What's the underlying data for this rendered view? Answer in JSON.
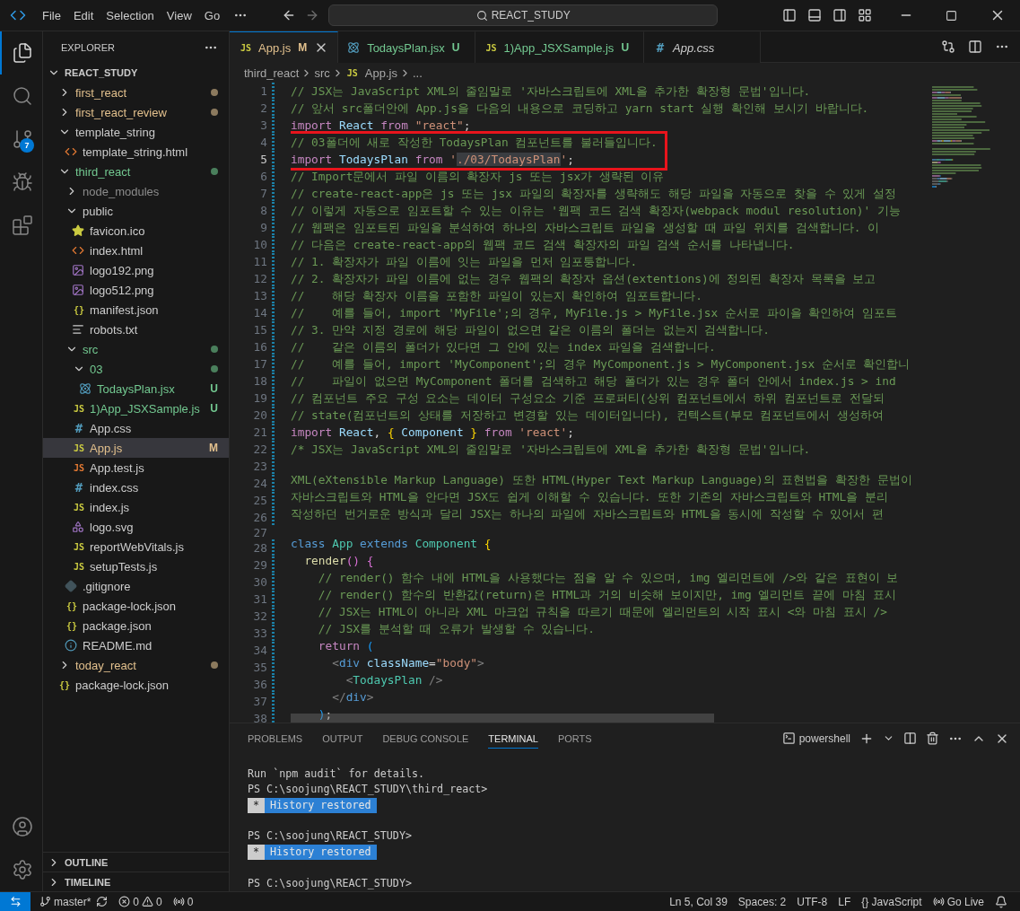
{
  "title_bar": {
    "menu": [
      "File",
      "Edit",
      "Selection",
      "View",
      "Go"
    ],
    "search": "REACT_STUDY"
  },
  "activity_bar": {
    "items": [
      {
        "kind": "explorer",
        "selected": true
      },
      {
        "kind": "search",
        "selected": false
      },
      {
        "kind": "source_control",
        "selected": false,
        "badge": "7"
      },
      {
        "kind": "run_debug",
        "selected": false
      },
      {
        "kind": "extensions",
        "selected": false
      }
    ],
    "bottom": [
      {
        "kind": "account"
      },
      {
        "kind": "settings"
      }
    ]
  },
  "sidebar": {
    "title": "EXPLORER",
    "root": {
      "label": "REACT_STUDY",
      "expanded": true,
      "children": [
        {
          "label": "first_react",
          "kind": "folder",
          "expanded": false,
          "color": "#e2c08d",
          "dot": true,
          "selected": false
        },
        {
          "label": "first_react_review",
          "kind": "folder",
          "expanded": false,
          "color": "#e2c08d",
          "dot": true,
          "selected": false
        },
        {
          "label": "template_string",
          "kind": "folder",
          "expanded": true,
          "dot": false,
          "selected": false,
          "children": [
            {
              "label": "template_string.html",
              "kind": "html",
              "dot": false,
              "selected": false
            }
          ]
        },
        {
          "label": "third_react",
          "kind": "folder",
          "expanded": true,
          "color": "#73c991",
          "dot": true,
          "selected": false,
          "children": [
            {
              "label": "node_modules",
              "kind": "folder",
              "expanded": false,
              "color": "#8c8c8c",
              "dot": false,
              "selected": false
            },
            {
              "label": "public",
              "kind": "folder",
              "expanded": true,
              "dot": false,
              "selected": false,
              "children": [
                {
                  "label": "favicon.ico",
                  "kind": "star",
                  "dot": false,
                  "selected": false
                },
                {
                  "label": "index.html",
                  "kind": "html",
                  "dot": false,
                  "selected": false
                },
                {
                  "label": "logo192.png",
                  "kind": "image",
                  "dot": false,
                  "selected": false
                },
                {
                  "label": "logo512.png",
                  "kind": "image",
                  "dot": false,
                  "selected": false
                },
                {
                  "label": "manifest.json",
                  "kind": "json",
                  "glyph": "{}",
                  "dot": false,
                  "selected": false
                },
                {
                  "label": "robots.txt",
                  "kind": "text",
                  "dot": false,
                  "selected": false
                }
              ]
            },
            {
              "label": "src",
              "kind": "folder",
              "expanded": true,
              "color": "#73c991",
              "dot": true,
              "selected": false,
              "children": [
                {
                  "label": "03",
                  "kind": "folder",
                  "expanded": true,
                  "color": "#73c991",
                  "dot": true,
                  "selected": false,
                  "children": [
                    {
                      "label": "TodaysPlan.jsx",
                      "kind": "react",
                      "color": "#73c991",
                      "badge": "U",
                      "dot": false,
                      "selected": false
                    }
                  ]
                },
                {
                  "label": "1)App_JSXSample.js",
                  "kind": "js",
                  "glyph": "JS",
                  "color": "#73c991",
                  "badge": "U",
                  "dot": false,
                  "selected": false
                },
                {
                  "label": "App.css",
                  "kind": "css",
                  "glyph": "#",
                  "dot": false,
                  "selected": false
                },
                {
                  "label": "App.js",
                  "kind": "js",
                  "glyph": "JS",
                  "color": "#e2c08d",
                  "badge": "M",
                  "dot": false,
                  "selected": true
                },
                {
                  "label": "App.test.js",
                  "kind": "test",
                  "glyph": "JS",
                  "dot": false,
                  "selected": false
                },
                {
                  "label": "index.css",
                  "kind": "css",
                  "glyph": "#",
                  "dot": false,
                  "selected": false
                },
                {
                  "label": "index.js",
                  "kind": "js",
                  "glyph": "JS",
                  "dot": false,
                  "selected": false
                },
                {
                  "label": "logo.svg",
                  "kind": "svg",
                  "dot": false,
                  "selected": false
                },
                {
                  "label": "reportWebVitals.js",
                  "kind": "js",
                  "glyph": "JS",
                  "dot": false,
                  "selected": false
                },
                {
                  "label": "setupTests.js",
                  "kind": "js",
                  "glyph": "JS",
                  "dot": false,
                  "selected": false
                }
              ]
            },
            {
              "label": ".gitignore",
              "kind": "git",
              "dot": false,
              "selected": false
            },
            {
              "label": "package-lock.json",
              "kind": "json",
              "glyph": "{}",
              "dot": false,
              "selected": false
            },
            {
              "label": "package.json",
              "kind": "json",
              "glyph": "{}",
              "dot": false,
              "selected": false
            },
            {
              "label": "README.md",
              "kind": "info",
              "dot": false,
              "selected": false
            }
          ]
        },
        {
          "label": "today_react",
          "kind": "folder",
          "expanded": false,
          "color": "#e2c08d",
          "dot": true,
          "selected": false
        },
        {
          "label": "package-lock.json",
          "kind": "json",
          "glyph": "{}",
          "dot": false,
          "selected": false
        }
      ]
    },
    "sections": [
      {
        "label": "OUTLINE",
        "expanded": false
      },
      {
        "label": "TIMELINE",
        "expanded": false
      }
    ]
  },
  "tabs": [
    {
      "label": "App.js",
      "kind": "js",
      "glyph": "JS",
      "badge": "M",
      "color": "#e2c08d",
      "selected": true,
      "preview": false
    },
    {
      "label": "TodaysPlan.jsx",
      "kind": "react",
      "badge": "U",
      "color": "#73c991",
      "selected": false,
      "preview": false
    },
    {
      "label": "1)App_JSXSample.js",
      "kind": "js",
      "glyph": "JS",
      "badge": "U",
      "color": "#73c991",
      "selected": false,
      "preview": false
    },
    {
      "label": "App.css",
      "kind": "css",
      "glyph": "#",
      "selected": false,
      "preview": true
    }
  ],
  "breadcrumb": [
    {
      "label": "third_react"
    },
    {
      "label": "src"
    },
    {
      "label": "App.js",
      "kind": "js",
      "glyph": "JS"
    },
    {
      "label": "..."
    }
  ],
  "editor": {
    "lines": [
      {
        "n": "1",
        "changed": true,
        "current": false,
        "boxed": false,
        "tokens": [
          {
            "kind": "comment",
            "text": "// JSX는 JavaScript XML의 줄임말로 '자바스크립트에 XML을 추가한 확장형 문법'입니다."
          }
        ]
      },
      {
        "n": "2",
        "changed": true,
        "current": false,
        "boxed": false,
        "tokens": [
          {
            "kind": "comment",
            "text": "// 앞서 src폴더안에 App.js을 다음의 내용으로 코딩하고 yarn start 실행 확인해 보시기 바랍니다."
          }
        ]
      },
      {
        "n": "3",
        "changed": true,
        "current": false,
        "boxed": false,
        "tokens": [
          {
            "kind": "keyword",
            "text": "import "
          },
          {
            "kind": "variable",
            "text": "React "
          },
          {
            "kind": "keyword",
            "text": "from "
          },
          {
            "kind": "string",
            "text": "\"react\""
          },
          {
            "kind": "punct",
            "text": ";"
          }
        ]
      },
      {
        "n": "4",
        "changed": true,
        "current": false,
        "boxed": true,
        "tokens": [
          {
            "kind": "comment",
            "text": "// 03폴더에 새로 작성한 TodaysPlan 컴포넌트를 불러들입니다."
          }
        ]
      },
      {
        "n": "5",
        "changed": true,
        "current": true,
        "boxed": true,
        "tokens": [
          {
            "kind": "keyword",
            "text": "import ",
            "selected": false
          },
          {
            "kind": "variable",
            "text": "TodaysPlan ",
            "selected": false
          },
          {
            "kind": "keyword",
            "text": "from ",
            "selected": false
          },
          {
            "kind": "string",
            "text": "'",
            "selected": false
          },
          {
            "kind": "string",
            "text": "./03/TodaysPlan",
            "selected": true
          },
          {
            "kind": "string",
            "text": "'",
            "selected": false
          },
          {
            "kind": "punct",
            "text": ";",
            "selected": false
          }
        ]
      },
      {
        "n": "6",
        "changed": true,
        "current": false,
        "boxed": false,
        "tokens": [
          {
            "kind": "comment",
            "text": "// Import문에서 파일 이름의 확장자 js 또는 jsx가 생략된 이유"
          }
        ]
      },
      {
        "n": "7",
        "changed": true,
        "current": false,
        "boxed": false,
        "tokens": [
          {
            "kind": "comment",
            "text": "// create-react-app은 js 또는 jsx 파일의 확장자를 생략해도 해당 파일을 자동으로 찾을 수 있게 설정"
          }
        ]
      },
      {
        "n": "8",
        "changed": true,
        "current": false,
        "boxed": false,
        "tokens": [
          {
            "kind": "comment",
            "text": "// 이렇게 자동으로 임포트할 수 있는 이유는 '웹팩 코드 검색 확장자(webpack modul resolution)' 기능"
          }
        ]
      },
      {
        "n": "9",
        "changed": true,
        "current": false,
        "boxed": false,
        "tokens": [
          {
            "kind": "comment",
            "text": "// 웹팩은 임포트된 파일을 분석하여 하나의 자바스크립트 파일을 생성할 때 파일 위치를 검색합니다. 이"
          }
        ]
      },
      {
        "n": "10",
        "changed": true,
        "current": false,
        "boxed": false,
        "tokens": [
          {
            "kind": "comment",
            "text": "// 다음은 create-react-app의 웹팩 코드 검색 확장자의 파일 검색 순서를 나타냅니다."
          }
        ]
      },
      {
        "n": "11",
        "changed": true,
        "current": false,
        "boxed": false,
        "tokens": [
          {
            "kind": "comment",
            "text": "// 1. 확장자가 파일 이름에 잇는 파일을 먼저 임포퉁합니다."
          }
        ]
      },
      {
        "n": "12",
        "changed": true,
        "current": false,
        "boxed": false,
        "tokens": [
          {
            "kind": "comment",
            "text": "// 2. 확장자가 파일 이름에 없는 경우 웹팩의 확장자 옵션(extentions)에 정의된 확장자 목록을 보고"
          }
        ]
      },
      {
        "n": "13",
        "changed": true,
        "current": false,
        "boxed": false,
        "tokens": [
          {
            "kind": "comment",
            "text": "//    해당 확장자 이름을 포함한 파일이 있는지 확인하여 임포트합니다."
          }
        ]
      },
      {
        "n": "14",
        "changed": true,
        "current": false,
        "boxed": false,
        "tokens": [
          {
            "kind": "comment",
            "text": "//    예를 들어, import 'MyFile';의 경우, MyFile.js > MyFile.jsx 순서로 파이을 확인하여 임포트"
          }
        ]
      },
      {
        "n": "15",
        "changed": true,
        "current": false,
        "boxed": false,
        "tokens": [
          {
            "kind": "comment",
            "text": "// 3. 만약 지정 경로에 해당 파일이 없으면 같은 이름의 폴더는 없는지 검색합니다."
          }
        ]
      },
      {
        "n": "16",
        "changed": true,
        "current": false,
        "boxed": false,
        "tokens": [
          {
            "kind": "comment",
            "text": "//    같은 이름의 폴더가 있다면 그 안에 있는 index 파일을 검색합니다."
          }
        ]
      },
      {
        "n": "17",
        "changed": true,
        "current": false,
        "boxed": false,
        "tokens": [
          {
            "kind": "comment",
            "text": "//    예를 들어, import 'MyComponent';의 경우 MyComponent.js > MyComponent.jsx 순서로 확인합니"
          }
        ]
      },
      {
        "n": "18",
        "changed": true,
        "current": false,
        "boxed": false,
        "tokens": [
          {
            "kind": "comment",
            "text": "//    파일이 없으면 MyComponent 폴더를 검색하고 해당 폴더가 있는 경우 폴더 안에서 index.js > ind"
          }
        ]
      },
      {
        "n": "19",
        "changed": true,
        "current": false,
        "boxed": false,
        "tokens": [
          {
            "kind": "comment",
            "text": "// 컴포넌트 주요 구성 요소는 데이터 구성요소 기준 프로퍼티(상위 컴포넌트에서 하위 컴포넌트로 전달되"
          }
        ]
      },
      {
        "n": "20",
        "changed": true,
        "current": false,
        "boxed": false,
        "tokens": [
          {
            "kind": "comment",
            "text": "// state(컴포넌트의 상태를 저장하고 변경할 있는 데이터입니다), 컨텍스트(부모 컴포넌트에서 생성하여"
          }
        ]
      },
      {
        "n": "21",
        "changed": true,
        "current": false,
        "boxed": false,
        "tokens": [
          {
            "kind": "keyword",
            "text": "import "
          },
          {
            "kind": "variable",
            "text": "React"
          },
          {
            "kind": "punct",
            "text": ", "
          },
          {
            "kind": "bracket1",
            "text": "{ "
          },
          {
            "kind": "variable",
            "text": "Component "
          },
          {
            "kind": "bracket1",
            "text": "} "
          },
          {
            "kind": "keyword",
            "text": "from "
          },
          {
            "kind": "string",
            "text": "'react'"
          },
          {
            "kind": "punct",
            "text": ";"
          }
        ]
      },
      {
        "n": "22",
        "changed": true,
        "current": false,
        "boxed": false,
        "tokens": [
          {
            "kind": "comment",
            "text": "/* JSX는 JavaScript XML의 줄임말로 '자바스크립트에 XML을 추가한 확장형 문법'입니다."
          }
        ]
      },
      {
        "n": "23",
        "changed": true,
        "current": false
      },
      {
        "n": "24",
        "changed": true,
        "current": false,
        "boxed": false,
        "tokens": [
          {
            "kind": "comment",
            "text": "XML(eXtensible Markup Language) 또한 HTML(Hyper Text Markup Language)의 표현법을 확장한 문법이"
          }
        ]
      },
      {
        "n": "25",
        "changed": true,
        "current": false,
        "boxed": false,
        "tokens": [
          {
            "kind": "comment",
            "text": "자바스크립트와 HTML을 안다면 JSX도 쉽게 이해할 수 있습니다. 또한 기존의 자바스크립트와 HTML을 분리"
          }
        ]
      },
      {
        "n": "26",
        "changed": true,
        "current": false,
        "boxed": false,
        "tokens": [
          {
            "kind": "comment",
            "text": "작성하던 번거로운 방식과 달리 JSX는 하나의 파일에 자바스크립트와 HTML을 동시에 작성할 수 있어서 편"
          }
        ]
      },
      {
        "n": "27",
        "changed": false,
        "current": false
      },
      {
        "n": "28",
        "changed": true,
        "current": false,
        "boxed": false,
        "tokens": [
          {
            "kind": "storage",
            "text": "class "
          },
          {
            "kind": "type",
            "text": "App "
          },
          {
            "kind": "storage",
            "text": "extends "
          },
          {
            "kind": "type",
            "text": "Component "
          },
          {
            "kind": "bracket1",
            "text": "{"
          }
        ]
      },
      {
        "n": "29",
        "changed": true,
        "current": false,
        "boxed": false,
        "tokens": [
          {
            "kind": "function",
            "text": "  render"
          },
          {
            "kind": "bracket2",
            "text": "() {"
          }
        ]
      },
      {
        "n": "30",
        "changed": true,
        "current": false,
        "boxed": false,
        "tokens": [
          {
            "kind": "comment",
            "text": "    // render() 함수 내에 HTML을 사용했다는 점을 알 수 있으며, img 엘리먼트에 />와 같은 표현이 보"
          }
        ]
      },
      {
        "n": "31",
        "changed": true,
        "current": false,
        "boxed": false,
        "tokens": [
          {
            "kind": "comment",
            "text": "    // render() 함수의 반환값(return)은 HTML과 거의 비슷해 보이지만, img 엘리먼트 끝에 마침 표시"
          }
        ]
      },
      {
        "n": "32",
        "changed": true,
        "current": false,
        "boxed": false,
        "tokens": [
          {
            "kind": "comment",
            "text": "    // JSX는 HTML이 아니라 XML 마크업 규칙을 따르기 때문에 엘리먼트의 시작 표시 <와 마침 표시 />"
          }
        ]
      },
      {
        "n": "33",
        "changed": true,
        "current": false,
        "boxed": false,
        "tokens": [
          {
            "kind": "comment",
            "text": "    // JSX를 분석할 때 오류가 발생할 수 있습니다."
          }
        ]
      },
      {
        "n": "34",
        "changed": true,
        "current": false,
        "boxed": false,
        "tokens": [
          {
            "kind": "keyword",
            "text": "    return "
          },
          {
            "kind": "bracket3",
            "text": "("
          }
        ]
      },
      {
        "n": "35",
        "changed": true,
        "current": false,
        "boxed": false,
        "tokens": [
          {
            "kind": "tagpunct",
            "text": "      <"
          },
          {
            "kind": "tag",
            "text": "div "
          },
          {
            "kind": "attr",
            "text": "className"
          },
          {
            "kind": "punct",
            "text": "="
          },
          {
            "kind": "string",
            "text": "\"body\""
          },
          {
            "kind": "tagpunct",
            "text": ">"
          }
        ]
      },
      {
        "n": "36",
        "changed": true,
        "current": false,
        "boxed": false,
        "tokens": [
          {
            "kind": "tagpunct",
            "text": "        <"
          },
          {
            "kind": "type",
            "text": "TodaysPlan "
          },
          {
            "kind": "tagpunct",
            "text": "/>"
          }
        ]
      },
      {
        "n": "37",
        "changed": true,
        "current": false,
        "boxed": false,
        "tokens": [
          {
            "kind": "tagpunct",
            "text": "      </"
          },
          {
            "kind": "tag",
            "text": "div"
          },
          {
            "kind": "tagpunct",
            "text": ">"
          }
        ]
      },
      {
        "n": "38",
        "changed": true,
        "current": false,
        "boxed": false,
        "tokens": [
          {
            "kind": "bracket3",
            "text": "    )"
          },
          {
            "kind": "punct",
            "text": ";"
          }
        ]
      }
    ]
  },
  "panel": {
    "tabs": [
      {
        "label": "PROBLEMS",
        "selected": false
      },
      {
        "label": "OUTPUT",
        "selected": false
      },
      {
        "label": "DEBUG CONSOLE",
        "selected": false
      },
      {
        "label": "TERMINAL",
        "selected": true
      },
      {
        "label": "PORTS",
        "selected": false
      }
    ],
    "shell": "powershell",
    "terminal": [
      {
        "kind": "text",
        "text": "Run `npm audit` for details."
      },
      {
        "kind": "text",
        "text": "PS C:\\soojung\\REACT_STUDY\\third_react>"
      },
      {
        "kind": "marker",
        "mark": "*",
        "text": "History restored"
      },
      {
        "kind": "blank"
      },
      {
        "kind": "text",
        "text": "PS C:\\soojung\\REACT_STUDY>"
      },
      {
        "kind": "marker",
        "mark": "*",
        "text": "History restored"
      },
      {
        "kind": "blank"
      },
      {
        "kind": "text",
        "text": "PS C:\\soojung\\REACT_STUDY>"
      }
    ]
  },
  "status_bar": {
    "branch": "master*",
    "errors": "0",
    "warnings": "0",
    "ports": "0",
    "right": [
      {
        "kind": "text",
        "text": "Ln 5, Col 39"
      },
      {
        "kind": "text",
        "text": "Spaces: 2"
      },
      {
        "kind": "text",
        "text": "UTF-8"
      },
      {
        "kind": "text",
        "text": "LF"
      },
      {
        "kind": "language",
        "glyph": "{}",
        "text": "JavaScript"
      },
      {
        "kind": "live",
        "text": "Go Live"
      },
      {
        "kind": "bell"
      }
    ]
  }
}
